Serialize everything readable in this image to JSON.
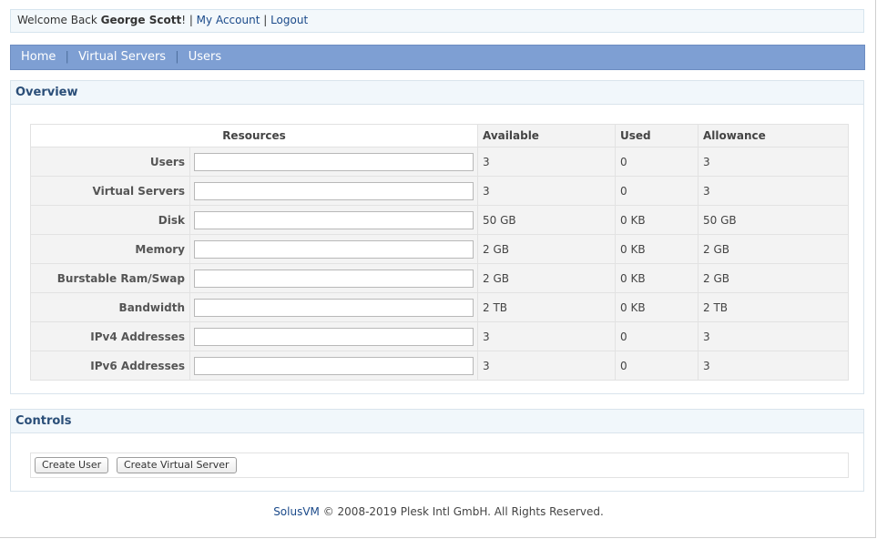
{
  "header": {
    "welcome_prefix": "Welcome Back ",
    "user_name": "George Scott",
    "welcome_suffix": "! | ",
    "my_account": "My Account",
    "divider": " | ",
    "logout": "Logout"
  },
  "nav": {
    "items": [
      {
        "label": "Home"
      },
      {
        "label": "Virtual Servers"
      },
      {
        "label": "Users"
      }
    ],
    "separator": "|"
  },
  "overview": {
    "title": "Overview",
    "columns": [
      "Resources",
      "Available",
      "Used",
      "Allowance"
    ],
    "rows": [
      {
        "label": "Users",
        "input": "",
        "available": "3",
        "used": "0",
        "allowance": "3"
      },
      {
        "label": "Virtual Servers",
        "input": "",
        "available": "3",
        "used": "0",
        "allowance": "3"
      },
      {
        "label": "Disk",
        "input": "",
        "available": "50 GB",
        "used": "0 KB",
        "allowance": "50 GB"
      },
      {
        "label": "Memory",
        "input": "",
        "available": "2 GB",
        "used": "0 KB",
        "allowance": "2 GB"
      },
      {
        "label": "Burstable Ram/Swap",
        "input": "",
        "available": "2 GB",
        "used": "0 KB",
        "allowance": "2 GB"
      },
      {
        "label": "Bandwidth",
        "input": "",
        "available": "2 TB",
        "used": "0 KB",
        "allowance": "2 TB"
      },
      {
        "label": "IPv4 Addresses",
        "input": "",
        "available": "3",
        "used": "0",
        "allowance": "3"
      },
      {
        "label": "IPv6 Addresses",
        "input": "",
        "available": "3",
        "used": "0",
        "allowance": "3"
      }
    ]
  },
  "controls": {
    "title": "Controls",
    "create_user": "Create User",
    "create_virtual_server": "Create Virtual Server"
  },
  "footer": {
    "brand": "SolusVM",
    "text": " © 2008-2019 Plesk Intl GmbH. All Rights Reserved."
  },
  "colors": {
    "nav_bg": "#7e9fd3",
    "panel_head_bg": "#f1f7fb",
    "link": "#1b4a8a",
    "heading": "#2a4e78"
  }
}
